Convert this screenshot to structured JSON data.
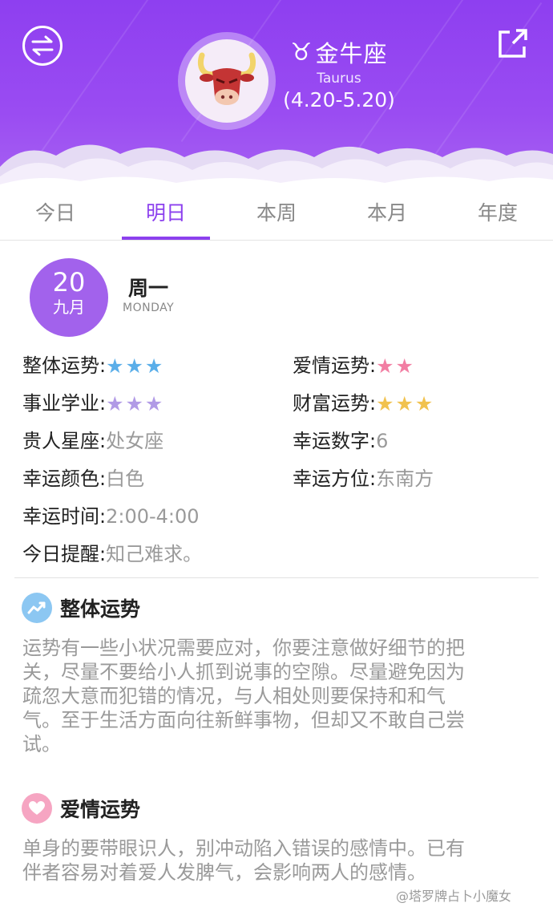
{
  "header": {
    "sign_symbol": "♉",
    "sign_name": "金牛座",
    "sign_en": "Taurus",
    "date_range": "(4.20-5.20)",
    "accent": "#9a4cf2",
    "swap_icon": "swap-arrows-icon",
    "share_icon": "share-external-icon",
    "avatar_icon": "bull-head-icon"
  },
  "tabs": [
    {
      "label": "今日",
      "active": false
    },
    {
      "label": "明日",
      "active": true
    },
    {
      "label": "本周",
      "active": false
    },
    {
      "label": "本月",
      "active": false
    },
    {
      "label": "年度",
      "active": false
    }
  ],
  "date": {
    "day": "20",
    "month": "九月",
    "weekday": "周一",
    "weekday_en": "MONDAY"
  },
  "fortune": {
    "overall": {
      "label": "整体运势:",
      "stars": "★★★",
      "rating": 3,
      "color": "#5aaee9"
    },
    "love": {
      "label": "爱情运势:",
      "stars": "★★",
      "rating": 2,
      "color": "#f27ea3"
    },
    "career": {
      "label": "事业学业:",
      "stars": "★★★",
      "rating": 3,
      "color": "#b19ae6"
    },
    "wealth": {
      "label": "财富运势:",
      "stars": "★★★",
      "rating": 3,
      "color": "#f1c24e"
    },
    "patron": {
      "label": "贵人星座:",
      "value": "处女座"
    },
    "lucky_number": {
      "label": "幸运数字:",
      "value": "6"
    },
    "lucky_color": {
      "label": "幸运颜色:",
      "value": "白色"
    },
    "lucky_direction": {
      "label": "幸运方位:",
      "value": "东南方"
    },
    "lucky_time": {
      "label": "幸运时间:",
      "value": "2:00-4:00"
    },
    "reminder": {
      "label": "今日提醒:",
      "value": "知己难求。"
    }
  },
  "sections": {
    "overall": {
      "title": "整体运势",
      "icon": "trend-chart-icon",
      "lines": [
        "运势有一些小状况需要应对，你要注意做好细节的把",
        "关，尽量不要给小人抓到说事的空隙。尽量避免因为",
        "疏忽大意而犯错的情况，与人相处则要保持和和气",
        "气。至于生活方面向往新鲜事物，但却又不敢自己尝",
        "试。"
      ]
    },
    "love": {
      "title": "爱情运势",
      "icon": "heart-icon",
      "lines": [
        "单身的要带眼识人，别冲动陷入错误的感情中。已有",
        "伴者容易对着爱人发脾气，会影响两人的感情。"
      ]
    }
  },
  "watermark": "@塔罗牌占卜小魔女"
}
